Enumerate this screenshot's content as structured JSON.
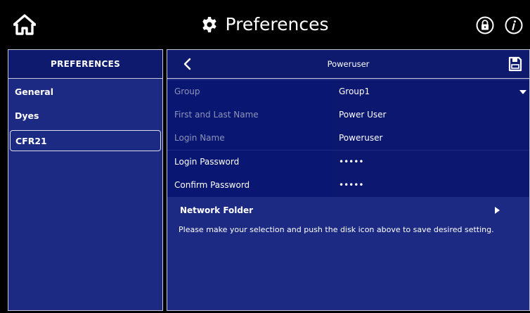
{
  "header": {
    "title": "Preferences",
    "icons": {
      "home": "home-icon",
      "settings": "gear-icon",
      "lock": "lock-icon",
      "info": "info-icon"
    }
  },
  "sidebar": {
    "heading": "PREFERENCES",
    "items": [
      {
        "label": "General",
        "selected": false
      },
      {
        "label": "Dyes",
        "selected": false
      },
      {
        "label": "CFR21",
        "selected": true
      }
    ]
  },
  "detail": {
    "title": "Poweruser",
    "fields": [
      {
        "label": "Group",
        "value": "Group1",
        "has_dropdown": true
      },
      {
        "label": "First and Last Name",
        "value": "Power User"
      },
      {
        "label": "Login Name",
        "value": "Poweruser"
      },
      {
        "label": "Login Password",
        "value": "•••••"
      },
      {
        "label": "Confirm Password",
        "value": "•••••"
      }
    ],
    "network_folder_label": "Network Folder",
    "message": "Please make your selection and push the disk icon above to save desired setting."
  },
  "colors": {
    "background": "#000000",
    "panel": "#1c2a83",
    "panel_header": "#0e1a6e",
    "field_bg": "#091772",
    "dim_text": "#8d93b8"
  }
}
